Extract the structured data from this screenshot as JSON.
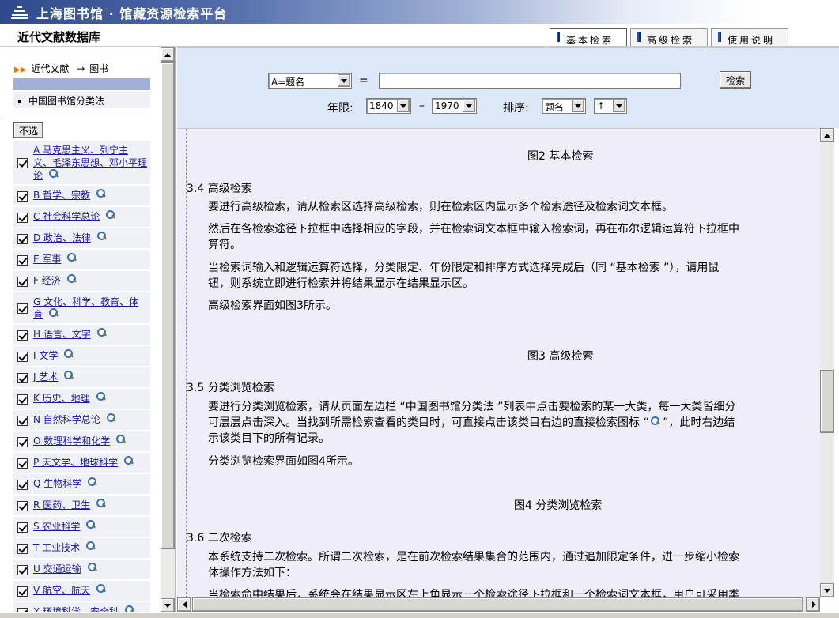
{
  "header": {
    "platform_title": "上海图书馆 · 馆藏资源检索平台",
    "database_title": "近代文献数据库",
    "tabs": [
      {
        "label": "基本检索",
        "active": true
      },
      {
        "label": "高级检索",
        "active": false
      },
      {
        "label": "使用说明",
        "active": false
      }
    ]
  },
  "sidebar": {
    "breadcrumb": {
      "root": "近代文献",
      "arrow": "→",
      "current": "图书"
    },
    "classification_title": "中国图书馆分类法",
    "unselect_label": "不选",
    "categories": [
      {
        "label": "A 马克思主义、列宁主义、毛泽东思想、邓小平理论",
        "checked": true
      },
      {
        "label": "B 哲学、宗教",
        "checked": true
      },
      {
        "label": "C 社会科学总论",
        "checked": true
      },
      {
        "label": "D 政治、法律",
        "checked": true
      },
      {
        "label": "E 军事",
        "checked": true
      },
      {
        "label": "F 经济",
        "checked": true
      },
      {
        "label": "G 文化、科学、教育、体育",
        "checked": true
      },
      {
        "label": "H 语言、文字",
        "checked": true
      },
      {
        "label": "I 文学",
        "checked": true
      },
      {
        "label": "J 艺术",
        "checked": true
      },
      {
        "label": "K 历史、地理",
        "checked": true
      },
      {
        "label": "N 自然科学总论",
        "checked": true
      },
      {
        "label": "O 数理科学和化学",
        "checked": true
      },
      {
        "label": "P 天文学、地球科学",
        "checked": true
      },
      {
        "label": "Q 生物科学",
        "checked": true
      },
      {
        "label": "R 医药、卫生",
        "checked": true
      },
      {
        "label": "S 农业科学",
        "checked": true
      },
      {
        "label": "T 工业技术",
        "checked": true
      },
      {
        "label": "U 交通运输",
        "checked": true
      },
      {
        "label": "V 航空、航天",
        "checked": true
      },
      {
        "label": "X 环境科学、安全科",
        "checked": true
      }
    ]
  },
  "search": {
    "field_select": "A=题名",
    "equals": "=",
    "query_value": "",
    "search_button": "检索",
    "year_label": "年限:",
    "year_from": "1840",
    "dash": "–",
    "year_to": "1970",
    "sort_label": "排序:",
    "sort_field": "题名",
    "sort_order": "↑"
  },
  "content": {
    "fig2": "图2 基本检索",
    "s34_heading": "3.4 高级检索",
    "s34_p1": "要进行高级检索，请从检索区选择高级检索，则在检索区内显示多个检索途径及检索词文本框。",
    "s34_p2a": "然后在各检索途径下拉框中选择相应的字段，并在检索词文本框中输入检索词，再在布尔逻辑运算符下拉框中",
    "s34_p2b": "算符。",
    "s34_p3a": "当检索词输入和逻辑运算符选择，分类限定、年份限定和排序方式选择完成后（同 “基本检索 ”），请用鼠",
    "s34_p3b": "钮，则系统立即进行检索并将结果显示在结果显示区。",
    "s34_p4": "高级检索界面如图3所示。",
    "fig3": "图3 高级检索",
    "s35_heading": "3.5 分类浏览检索",
    "s35_p1a": "要进行分类浏览检索，请从页面左边栏 “中国图书馆分类法 ”列表中点击要检索的某一大类，每一大类皆细分",
    "s35_p1b": "可层层点击深入。当找到所需检索查看的类目时，可直接点击该类目右边的直接检索图标 “",
    "s35_p1b2": " ”，此时右边结",
    "s35_p1c": "示该类目下的所有记录。",
    "s35_p2": "分类浏览检索界面如图4所示。",
    "fig4": "图4 分类浏览检索",
    "s36_heading": "3.6 二次检索",
    "s36_p1a": "本系统支持二次检索。所谓二次检索，是在前次检索结果集合的范围内，通过追加限定条件，进一步缩小检索",
    "s36_p1b": "体操作方法如下：",
    "s36_p2": "当检索命中结果后，系统会在结果显示区左上角显示一个检索途径下拉框和一个检索词文本框，用户可采用类"
  }
}
